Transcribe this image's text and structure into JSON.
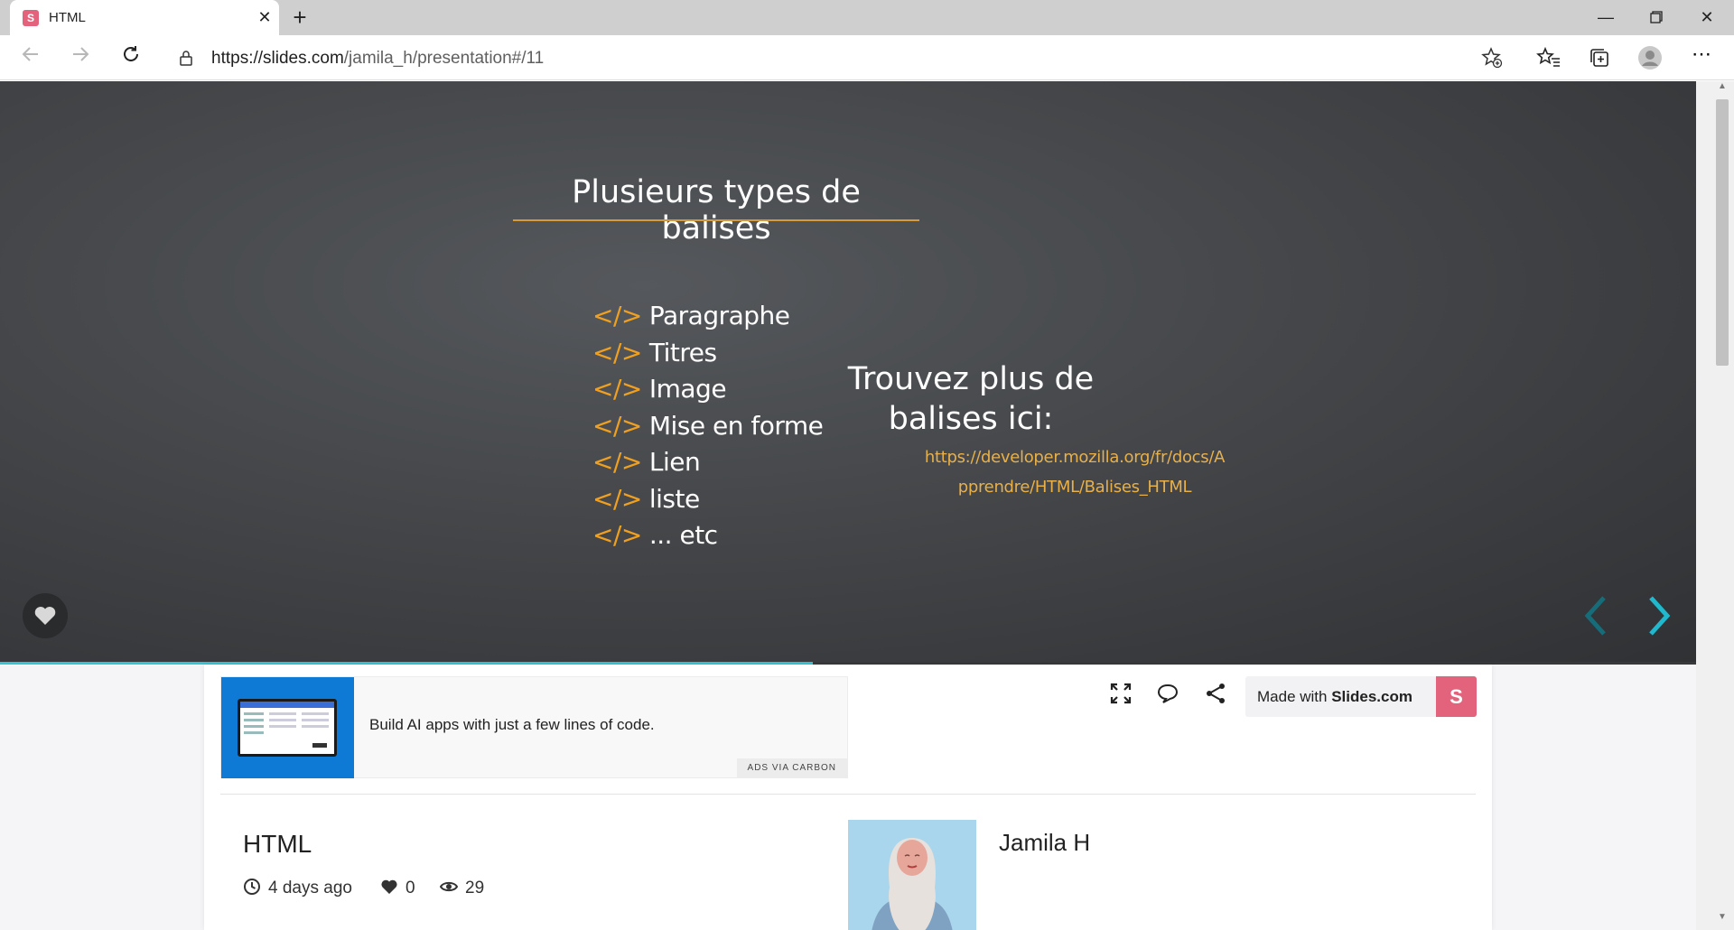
{
  "browser": {
    "tab_title": "HTML",
    "tab_favicon": "S",
    "url_domain": "https://slides.com",
    "url_path": "/jamila_h/presentation#/11",
    "icons": [
      "back-icon",
      "forward-icon",
      "reload-icon",
      "lock-icon",
      "add-favorite-icon",
      "favorites-icon",
      "collections-icon",
      "profile-icon",
      "more-icon"
    ],
    "window_controls": [
      "minimize-icon",
      "restore-icon",
      "close-icon"
    ]
  },
  "slide": {
    "title": "Plusieurs types de balises",
    "tag_prefix": "</>",
    "tags": [
      "Paragraphe",
      "Titres",
      "Image",
      "Mise en forme",
      "Lien",
      "liste",
      "... etc"
    ],
    "find_more_line1": "Trouvez plus de",
    "find_more_line2": "balises ici:",
    "link_line1": "https://developer.mozilla.org/fr/docs/A",
    "link_line2": "pprendre/HTML/Balises_HTML",
    "progress_fraction": 0.479,
    "colors": {
      "accent": "#f0a020",
      "link": "#e7b04a",
      "progress": "#36c3d3",
      "arrow_next": "#1fb8cc",
      "arrow_prev": "#166c78"
    }
  },
  "ad": {
    "text": "Build AI apps with just a few lines of code.",
    "via": "ADS VIA CARBON"
  },
  "deck": {
    "made_with_prefix": "Made with",
    "made_with_brand": "Slides.com",
    "brand_badge": "S",
    "title": "HTML",
    "age": "4 days ago",
    "likes": "0",
    "views": "29",
    "author": "Jamila H",
    "icons": [
      "fullscreen-icon",
      "comment-icon",
      "share-icon",
      "clock-icon",
      "heart-icon",
      "eye-icon"
    ]
  }
}
